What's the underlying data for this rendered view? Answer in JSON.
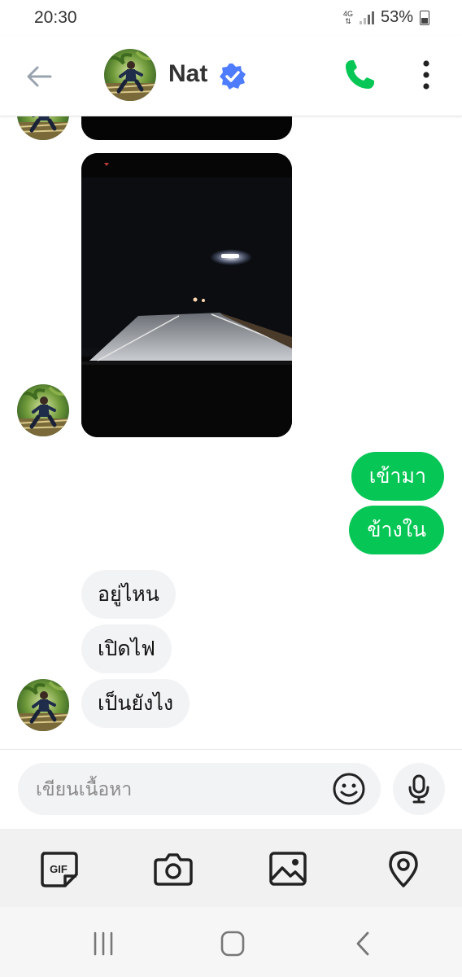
{
  "status_bar": {
    "time": "20:30",
    "network": "4G",
    "battery_percent": "53%"
  },
  "header": {
    "contact_name": "Nat",
    "verified": true,
    "icons": [
      "back-arrow-icon",
      "verified-badge-icon",
      "phone-icon",
      "more-vertical-icon"
    ]
  },
  "chat": {
    "messages": [
      {
        "type": "video",
        "direction": "incoming"
      },
      {
        "type": "video",
        "direction": "incoming"
      },
      {
        "type": "text",
        "direction": "outgoing",
        "text": "เข้ามา"
      },
      {
        "type": "text",
        "direction": "outgoing",
        "text": "ข้างใน"
      },
      {
        "type": "text",
        "direction": "incoming",
        "text": "อยู่ไหน"
      },
      {
        "type": "text",
        "direction": "incoming",
        "text": "เปิดไฟ"
      },
      {
        "type": "text",
        "direction": "incoming",
        "text": "เป็นยังไง"
      }
    ]
  },
  "composer": {
    "placeholder": "เขียนเนื้อหา",
    "value": ""
  },
  "toolbar": {
    "gif_label": "GIF",
    "icons": [
      "gif-icon",
      "camera-icon",
      "image-icon",
      "location-icon"
    ]
  },
  "navbar": {
    "icons": [
      "recent-apps-icon",
      "home-icon",
      "back-icon"
    ]
  },
  "colors": {
    "accent": "#06c755",
    "verified": "#4e7cff",
    "incoming_bubble": "#f2f3f5"
  }
}
